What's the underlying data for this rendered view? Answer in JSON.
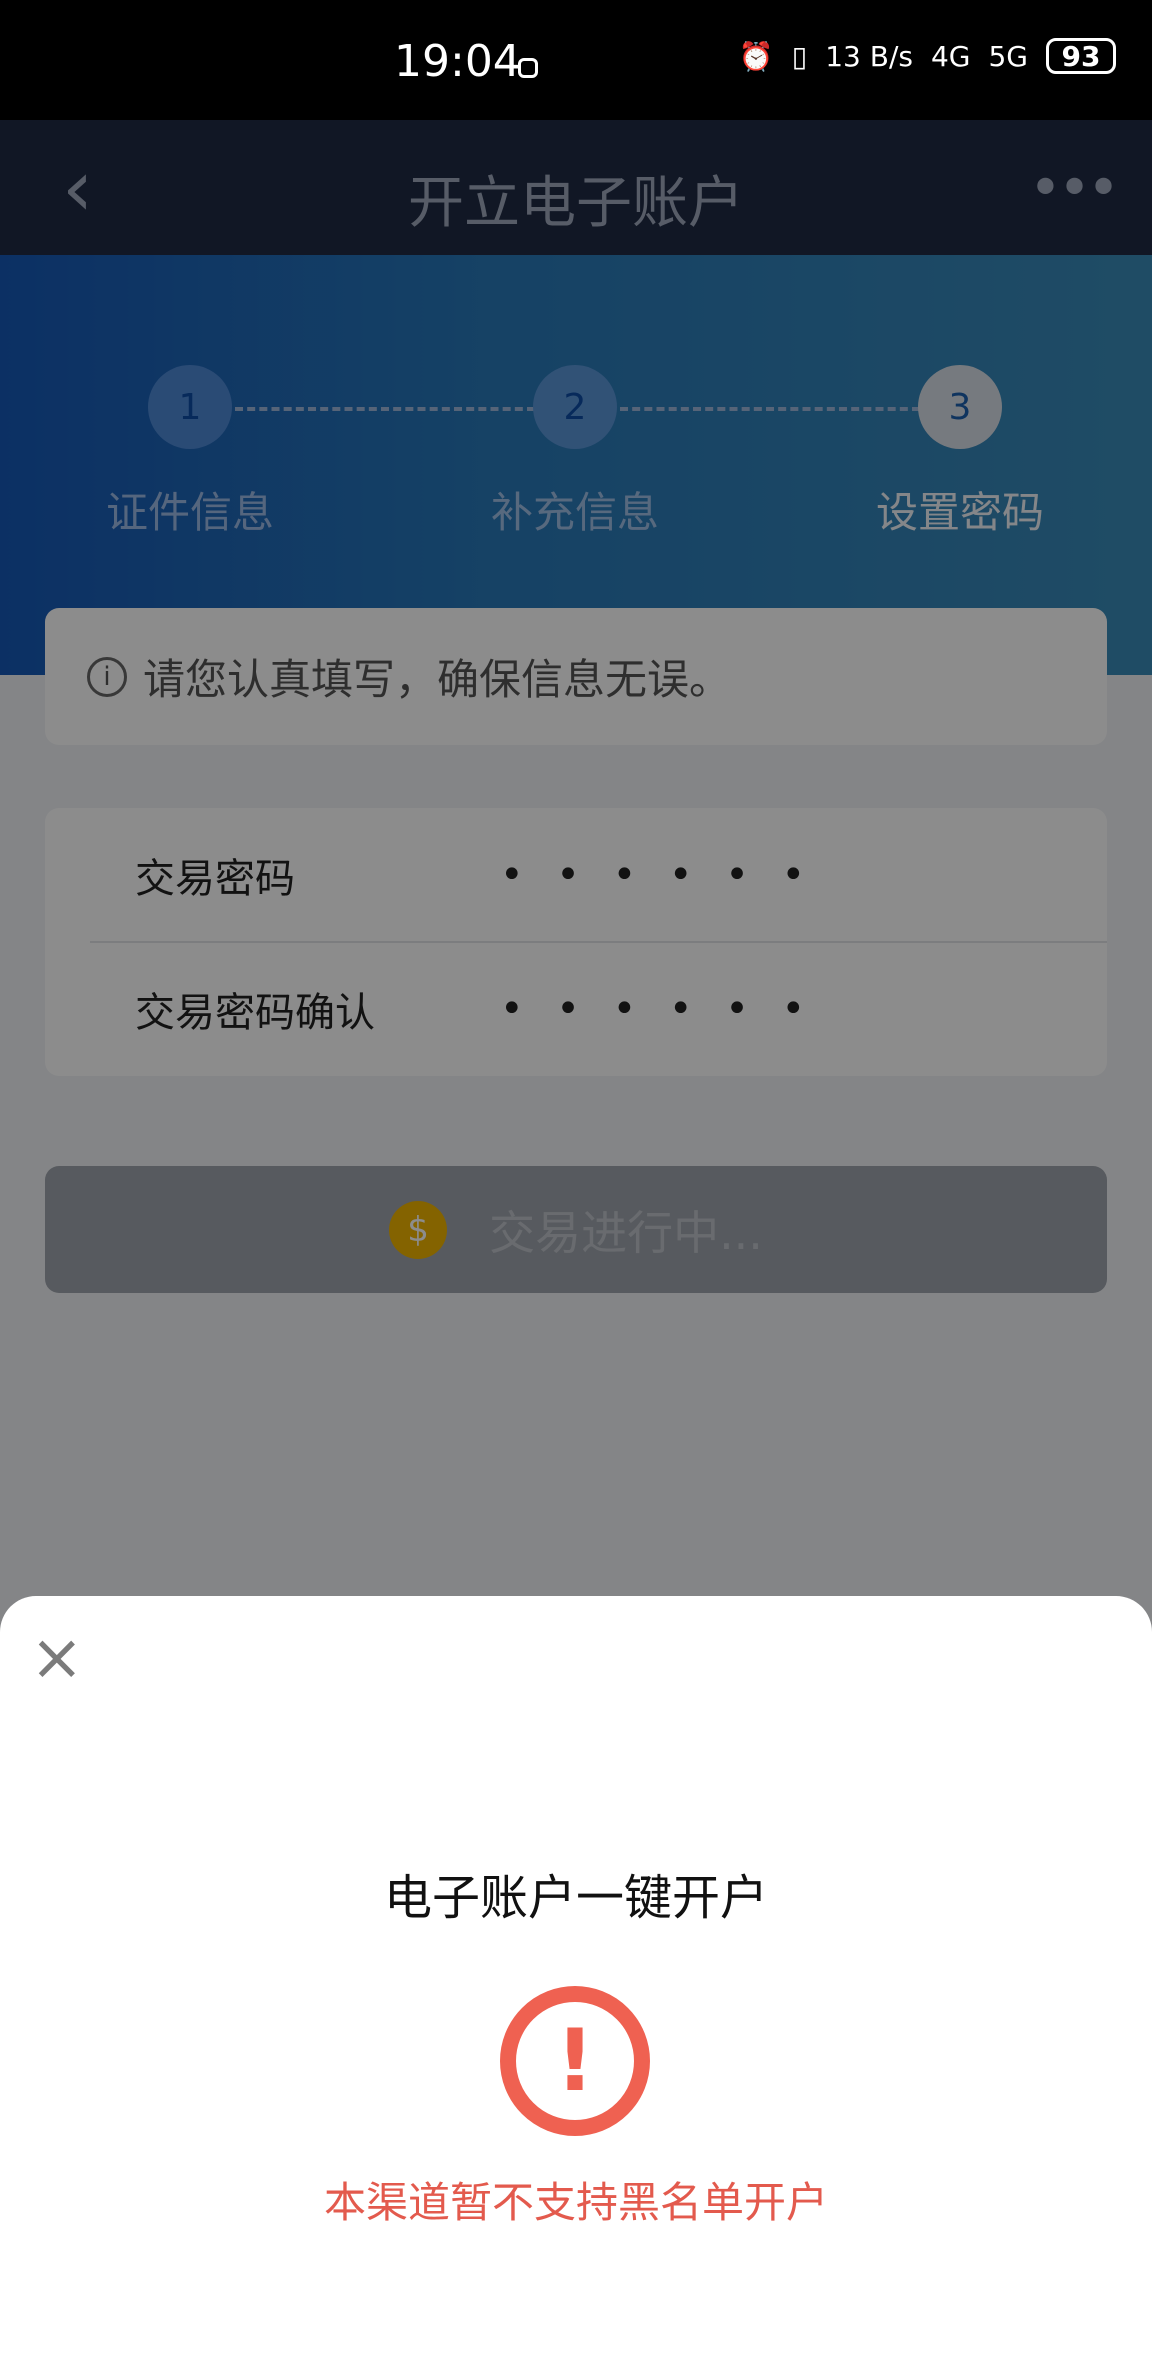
{
  "status_bar": {
    "time": "19:04",
    "network_speed": "13 B/s",
    "network_4g": "4G",
    "network_5g": "5G",
    "battery": "93"
  },
  "navbar": {
    "title": "开立电子账户",
    "back_icon": "chevron-left-icon",
    "more_icon": "more-dots-icon"
  },
  "steps": [
    {
      "number": "1",
      "label": "证件信息"
    },
    {
      "number": "2",
      "label": "补充信息"
    },
    {
      "number": "3",
      "label": "设置密码"
    }
  ],
  "info": {
    "text": "请您认真填写，确保信息无误。"
  },
  "password": {
    "rows": [
      {
        "label": "交易密码",
        "value": "• • • • • •"
      },
      {
        "label": "交易密码确认",
        "value": "• • • • • •"
      }
    ]
  },
  "button": {
    "label": "交易进行中..."
  },
  "sheet": {
    "title": "电子账户一键开户",
    "message": "本渠道暂不支持黑名单开户"
  },
  "colors": {
    "navbar": "#1f2a44",
    "hero_start": "#1658b7",
    "hero_end": "#3a8bb8",
    "alert": "#ef6151",
    "alert_text": "#e35a4d"
  }
}
